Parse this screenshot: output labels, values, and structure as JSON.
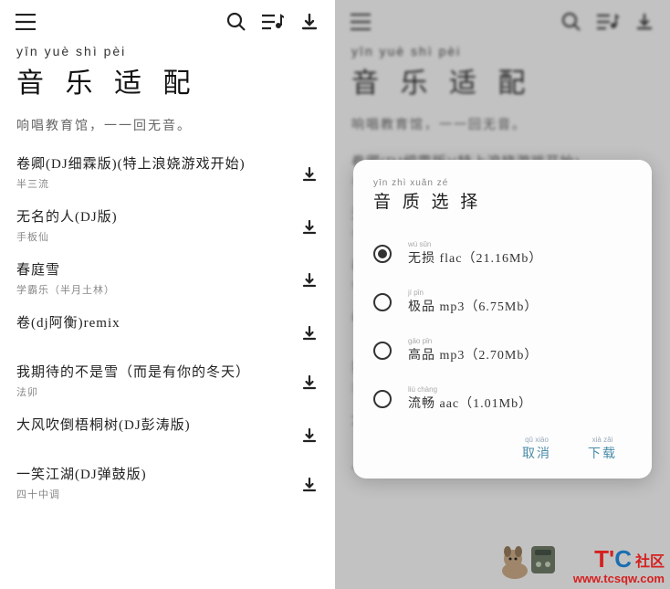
{
  "app": {
    "pinyin": "yīn  yuè  shì  pèi",
    "title": "音 乐 适 配",
    "subtitle_pinyin": "",
    "subtitle": "响唱教育馆，一一回无音。"
  },
  "songs": [
    {
      "pinyin": "",
      "title": "卷卿(DJ细霖版)(特上浪娆游戏开始)",
      "artist_pinyin": "",
      "artist": "半三流"
    },
    {
      "pinyin": "",
      "title": "无名的人(DJ版)",
      "artist_pinyin": "",
      "artist": "手板仙"
    },
    {
      "pinyin": "",
      "title": "春庭雪",
      "artist_pinyin": "",
      "artist": "学霸乐（半月土林）"
    },
    {
      "pinyin": "",
      "title": "卷(dj阿衡)remix",
      "artist_pinyin": "",
      "artist": ""
    },
    {
      "pinyin": "",
      "title": "我期待的不是雪（而是有你的冬天）",
      "artist_pinyin": "",
      "artist": "法卯"
    },
    {
      "pinyin": "",
      "title": "大风吹倒梧桐树(DJ彭涛版)",
      "artist_pinyin": "",
      "artist": ""
    },
    {
      "pinyin": "",
      "title": "一笑江湖(DJ弹鼓版)",
      "artist_pinyin": "",
      "artist": "四十中调"
    }
  ],
  "songs_right": [
    {
      "title": "卷卿(DJ细霖版)(特上浪娆游戏开始)",
      "artist": "半三流"
    },
    {
      "title": "无名的人(DJ版)",
      "artist": "手板仙"
    },
    {
      "title": "春庭雪",
      "artist": "学霸乐"
    },
    {
      "title": "卷(dj阿衡)remix",
      "artist": ""
    },
    {
      "title": "我期待的不是雪（而是有你的冬天）",
      "artist": "法卯"
    },
    {
      "title": "大风吹倒梧桐树(DJ彭涛版)",
      "artist": ""
    },
    {
      "title": "一笑江湖(DJ弹鼓版)",
      "artist": ""
    }
  ],
  "dialog": {
    "title_pinyin": "yīn  zhì  xuǎn  zé",
    "title": "音 质 选 择",
    "options": [
      {
        "pinyin": "wú sǔn",
        "label": "无损 flac（21.16Mb）",
        "selected": true
      },
      {
        "pinyin": "jí pǐn",
        "label": "极品 mp3（6.75Mb）",
        "selected": false
      },
      {
        "pinyin": "gāo pǐn",
        "label": "高品 mp3（2.70Mb）",
        "selected": false
      },
      {
        "pinyin": "liú chàng",
        "label": "流畅 aac（1.01Mb）",
        "selected": false
      }
    ],
    "cancel_pinyin": "qǔ xiāo",
    "cancel": "取消",
    "confirm_pinyin": "xià zǎi",
    "confirm": "下载"
  },
  "watermark": {
    "brand_t": "T",
    "brand_c": "C",
    "brand_suffix": "社区",
    "url": "www.tcsqw.com"
  }
}
